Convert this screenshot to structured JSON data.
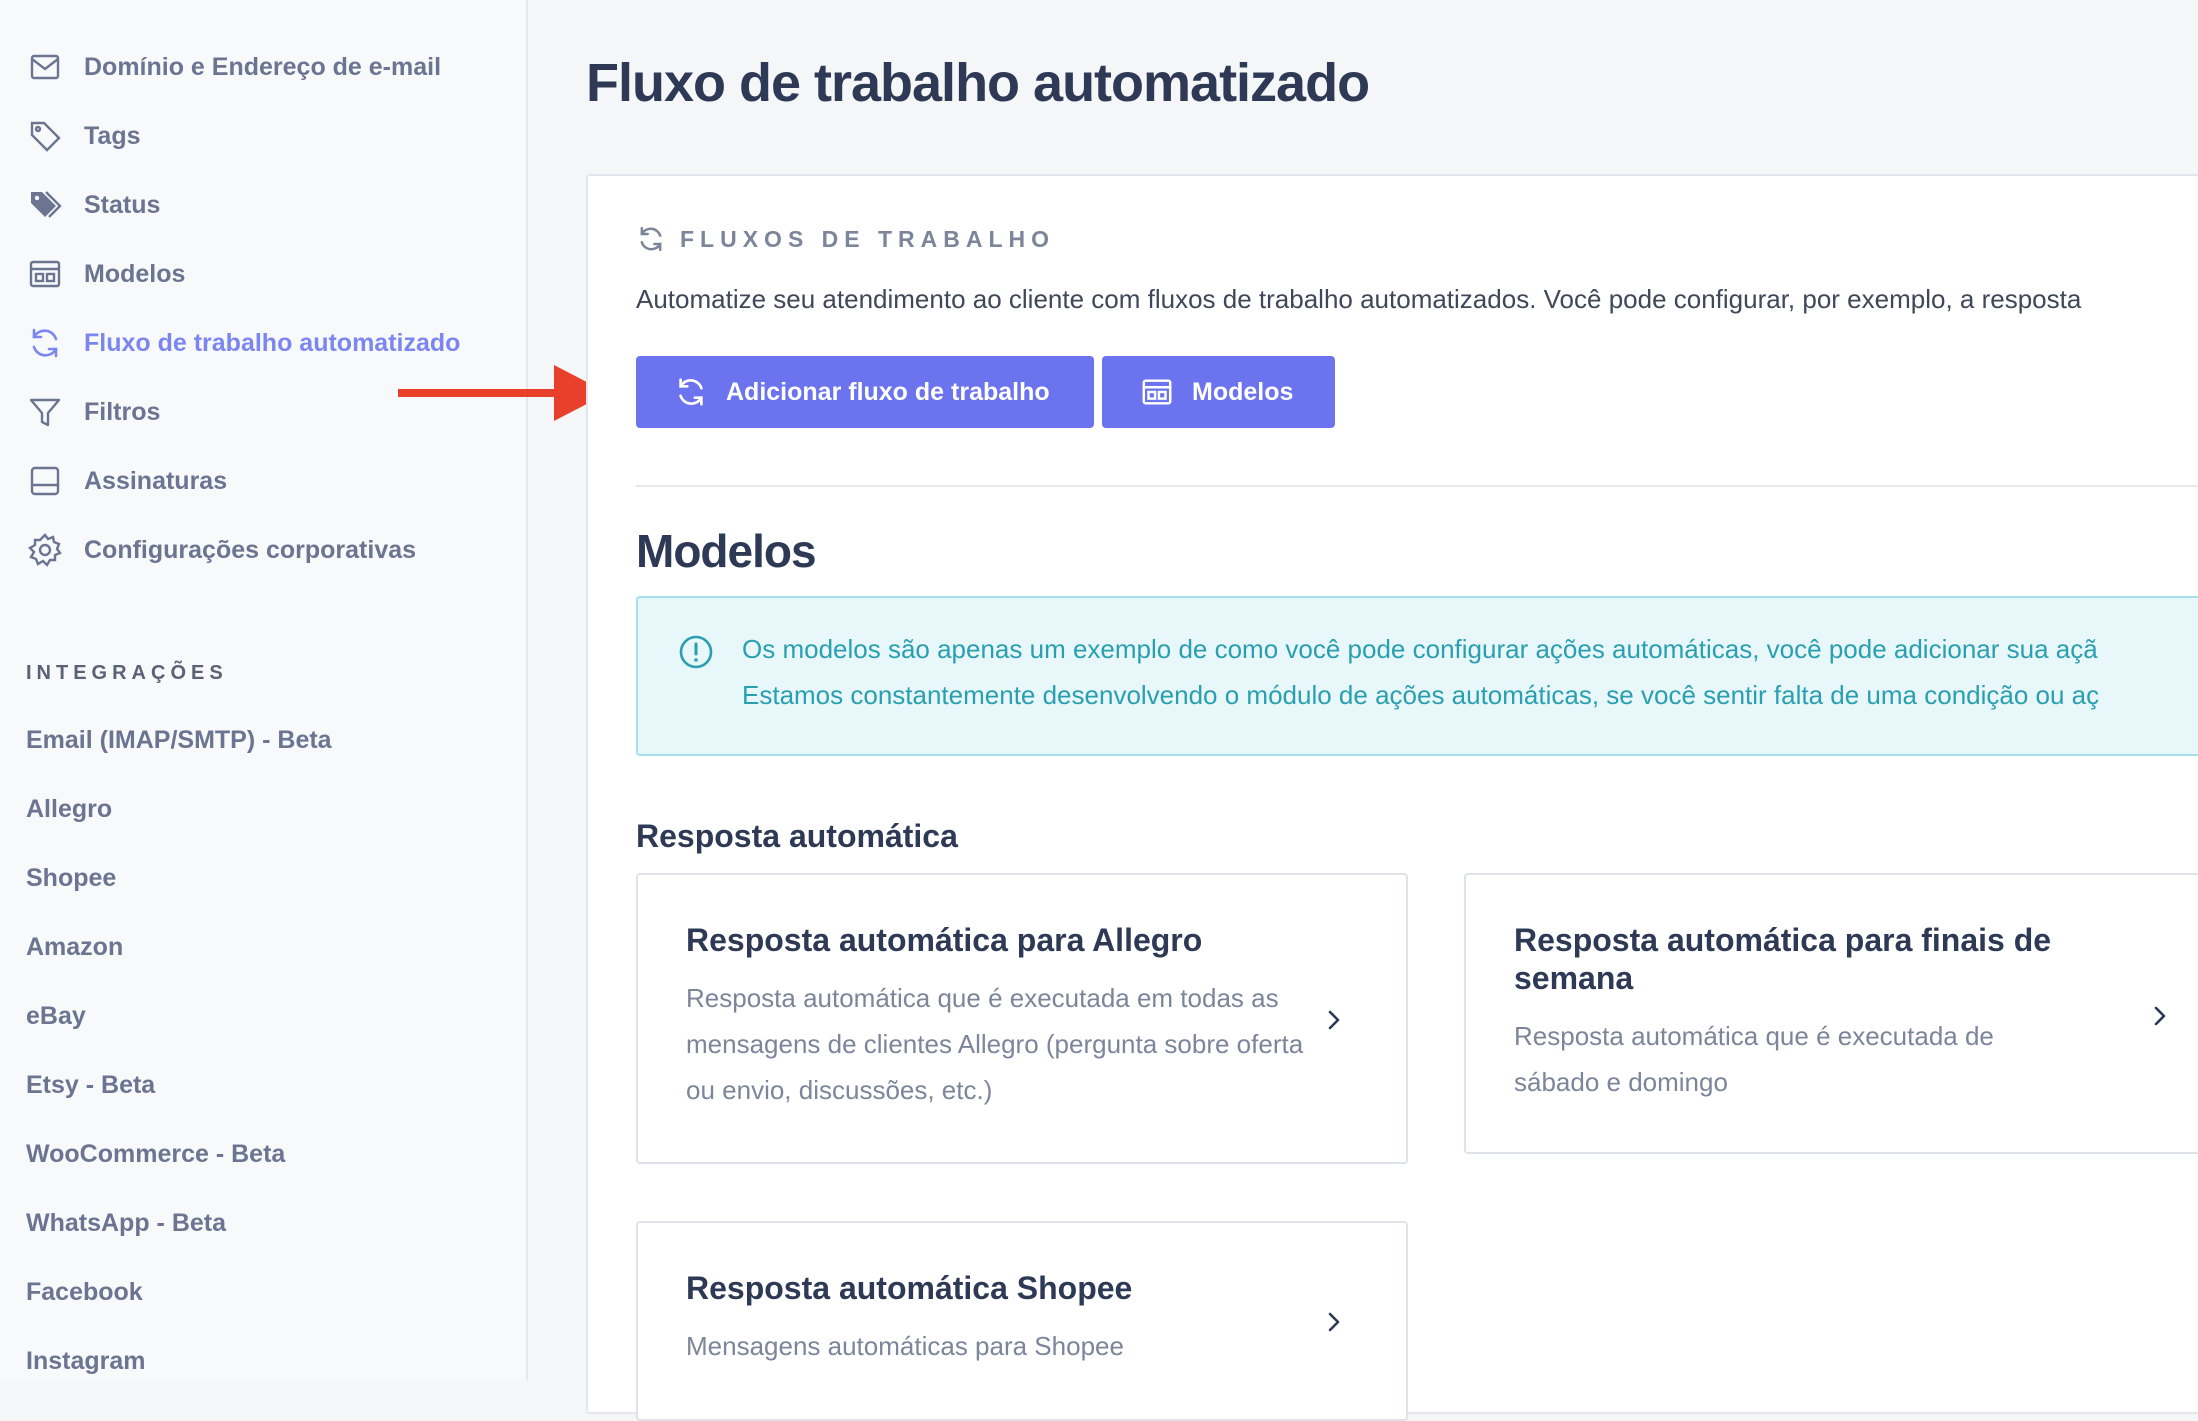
{
  "sidebar": {
    "items": [
      {
        "label": "Domínio e Endereço de e-mail",
        "icon": "mail-icon"
      },
      {
        "label": "Tags",
        "icon": "tag-icon"
      },
      {
        "label": "Status",
        "icon": "tags-filled-icon"
      },
      {
        "label": "Modelos",
        "icon": "template-icon"
      },
      {
        "label": "Fluxo de trabalho automatizado",
        "icon": "refresh-icon",
        "active": true
      },
      {
        "label": "Filtros",
        "icon": "filter-icon"
      },
      {
        "label": "Assinaturas",
        "icon": "signature-icon"
      },
      {
        "label": "Configurações corporativas",
        "icon": "gear-icon"
      }
    ],
    "integrations_heading": "INTEGRAÇÕES",
    "integrations": [
      "Email (IMAP/SMTP) - Beta",
      "Allegro",
      "Shopee",
      "Amazon",
      "eBay",
      "Etsy - Beta",
      "WooCommerce - Beta",
      "WhatsApp - Beta",
      "Facebook",
      "Instagram"
    ]
  },
  "main": {
    "page_title": "Fluxo de trabalho automatizado",
    "panel_heading": "FLUXOS DE TRABALHO",
    "panel_description": "Automatize seu atendimento ao cliente com fluxos de trabalho automatizados. Você pode configurar, por exemplo, a resposta",
    "add_button_label": "Adicionar fluxo de trabalho",
    "models_button_label": "Modelos",
    "models_section_title": "Modelos",
    "info_line_1": "Os modelos são apenas um exemplo de como você pode configurar ações automáticas, você pode adicionar sua açã",
    "info_line_2": "Estamos constantemente desenvolvendo o módulo de ações automáticas, se você sentir falta de uma condição ou aç",
    "auto_reply_title": "Resposta automática",
    "cards": [
      {
        "title": "Resposta automática para Allegro",
        "description": "Resposta automática que é executada em todas as mensagens de clientes Allegro (pergunta sobre oferta ou envio, discussões, etc.)"
      },
      {
        "title": "Resposta automática para finais de semana",
        "description": "Resposta automática que é executada de sábado e domingo"
      },
      {
        "title": "Resposta automática Shopee",
        "description": "Mensagens automáticas para Shopee"
      }
    ]
  },
  "colors": {
    "accent": "#6b73ef",
    "active_nav": "#7c86f0",
    "info_text": "#2a9fb0",
    "annotation_arrow": "#e8402a"
  }
}
